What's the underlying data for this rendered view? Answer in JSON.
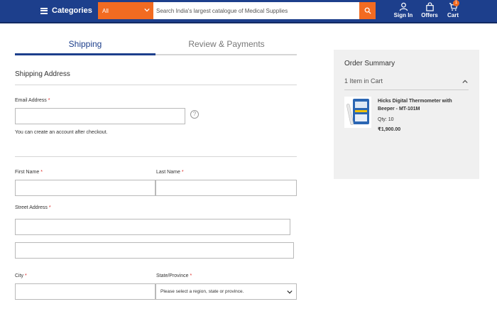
{
  "header": {
    "categories_label": "Categories",
    "category_select": "All",
    "search_placeholder": "Search India's largest catalogue of Medical Supplies",
    "sign_in_label": "Sign In",
    "offers_label": "Offers",
    "cart_label": "Cart",
    "cart_count": "1",
    "accent_color": "#f26b21",
    "brand_color": "#1d3f8c"
  },
  "tabs": [
    {
      "label": "Shipping",
      "active": true
    },
    {
      "label": "Review & Payments",
      "active": false
    }
  ],
  "form": {
    "section_title": "Shipping Address",
    "email_label": "Email Address",
    "required_mark": "*",
    "email_value": "",
    "account_hint": "You can create an account after checkout.",
    "first_name_label": "First Name",
    "last_name_label": "Last Name",
    "street_label": "Street Address",
    "city_label": "City",
    "state_label": "State/Province",
    "state_placeholder": "Please select a region, state or province."
  },
  "order_summary": {
    "title": "Order Summary",
    "items_in_cart": "1 Item in Cart",
    "product_name": "Hicks Digital Thermometer with Beeper - MT-101M",
    "qty": "Qty: 10",
    "price": "₹1,900.00"
  }
}
